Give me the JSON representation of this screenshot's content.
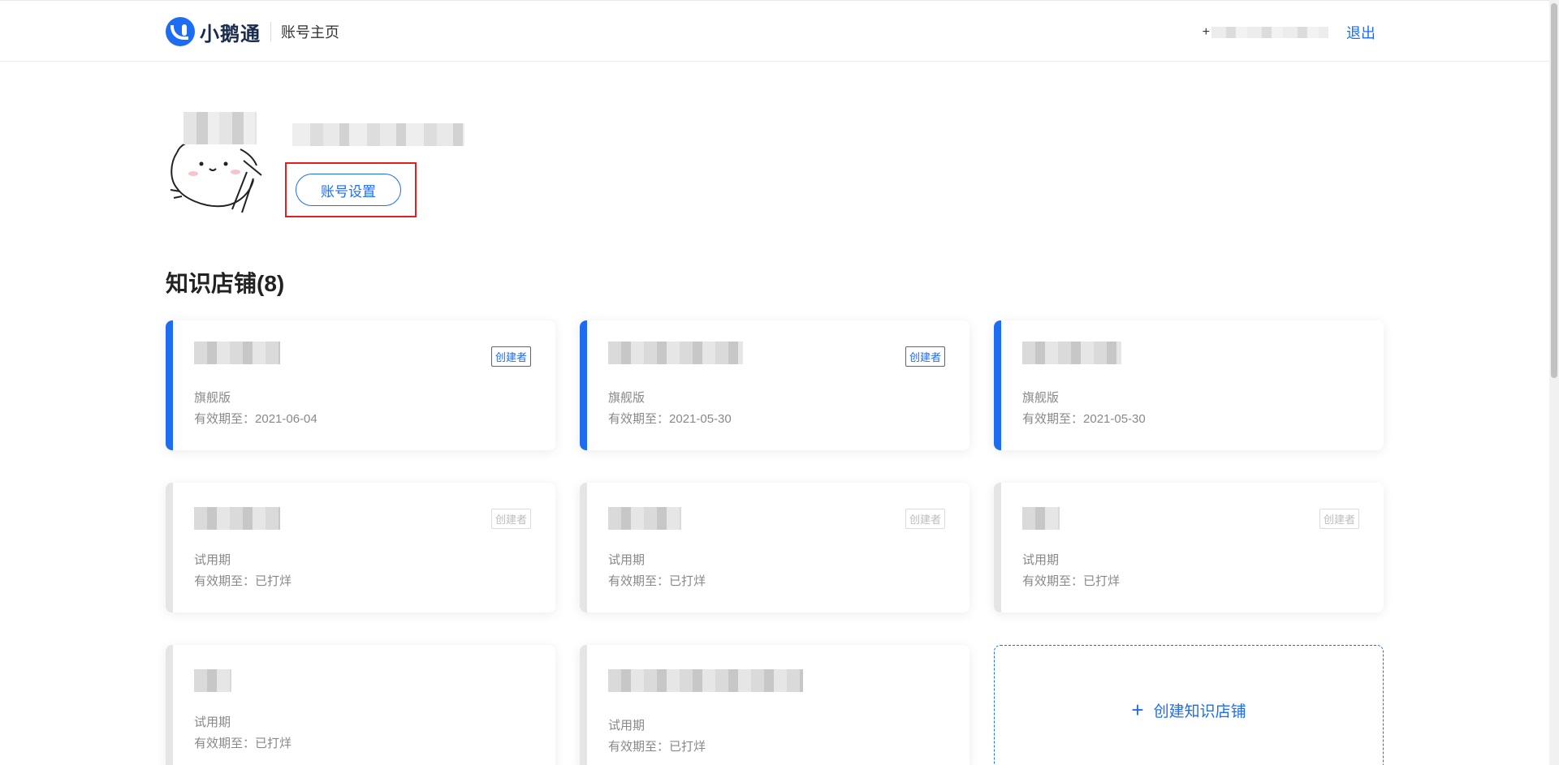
{
  "header": {
    "logo_text": "小鹅通",
    "subtitle": "账号主页",
    "phone_prefix": "+",
    "logout_label": "退出"
  },
  "profile": {
    "settings_label": "账号设置"
  },
  "section": {
    "title": "知识店铺(8)"
  },
  "stores": [
    {
      "badge": "创建者",
      "plan": "旗舰版",
      "expire_label": "有效期至：",
      "expire_value": "2021-06-04",
      "status": "active"
    },
    {
      "badge": "创建者",
      "plan": "旗舰版",
      "expire_label": "有效期至：",
      "expire_value": "2021-05-30",
      "status": "active"
    },
    {
      "badge": "",
      "plan": "旗舰版",
      "expire_label": "有效期至：",
      "expire_value": "2021-05-30",
      "status": "active"
    },
    {
      "badge": "创建者",
      "plan": "试用期",
      "expire_label": "有效期至：",
      "expire_value": "已打烊",
      "status": "trial"
    },
    {
      "badge": "创建者",
      "plan": "试用期",
      "expire_label": "有效期至：",
      "expire_value": "已打烊",
      "status": "trial"
    },
    {
      "badge": "创建者",
      "plan": "试用期",
      "expire_label": "有效期至：",
      "expire_value": "已打烊",
      "status": "trial"
    },
    {
      "badge": "",
      "plan": "试用期",
      "expire_label": "有效期至：",
      "expire_value": "已打烊",
      "status": "trial"
    },
    {
      "badge": "",
      "plan": "试用期",
      "expire_label": "有效期至：",
      "expire_value": "已打烊",
      "status": "trial"
    }
  ],
  "create_store": {
    "icon": "plus-icon",
    "plus": "+",
    "label": "创建知识店铺"
  },
  "colors": {
    "brand": "#1e6cf2",
    "highlight": "#e02020",
    "trial_bar": "#e5e5e5"
  }
}
